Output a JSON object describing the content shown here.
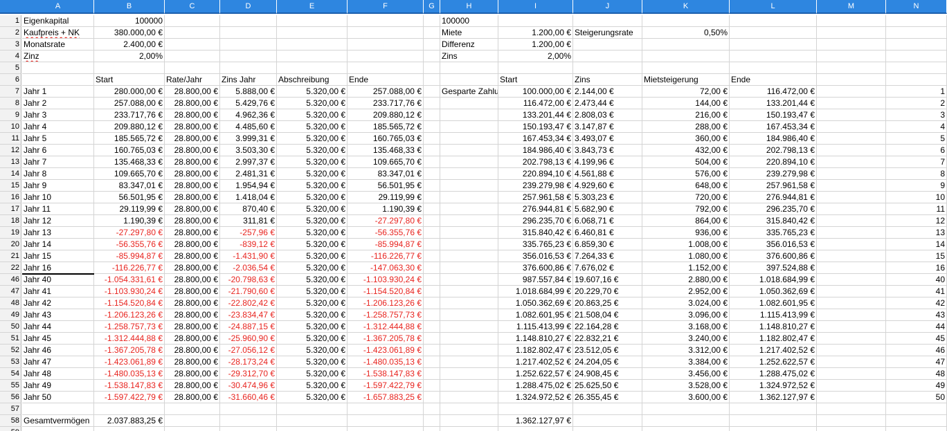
{
  "columns": [
    "A",
    "B",
    "C",
    "D",
    "E",
    "F",
    "G",
    "H",
    "I",
    "J",
    "K",
    "L",
    "M",
    "N"
  ],
  "rows": [
    {
      "n": "1",
      "cells": [
        "Eigenkapital",
        "100000",
        "",
        "",
        "",
        "",
        "",
        "100000",
        "",
        "",
        "",
        "",
        "",
        ""
      ]
    },
    {
      "n": "2",
      "cells": [
        "Kaufpreis + NK",
        "380.000,00 €",
        "",
        "",
        "",
        "",
        "",
        "Miete",
        "1.200,00 €",
        "Steigerungsrate",
        "0,50%",
        "",
        "",
        ""
      ]
    },
    {
      "n": "3",
      "cells": [
        "Monatsrate",
        "2.400,00 €",
        "",
        "",
        "",
        "",
        "",
        "Differenz",
        "1.200,00 €",
        "",
        "",
        "",
        "",
        ""
      ]
    },
    {
      "n": "4",
      "cells": [
        "Zinz",
        "2,00%",
        "",
        "",
        "",
        "",
        "",
        "Zins",
        "2,00%",
        "",
        "",
        "",
        "",
        ""
      ]
    },
    {
      "n": "5",
      "cells": [
        "",
        "",
        "",
        "",
        "",
        "",
        "",
        "",
        "",
        "",
        "",
        "",
        "",
        ""
      ]
    },
    {
      "n": "6",
      "cells": [
        "",
        "Start",
        "Rate/Jahr",
        "Zins Jahr",
        "Abschreibung",
        "Ende",
        "",
        "",
        "Start",
        "Zins",
        "Mietsteigerung",
        "Ende",
        "",
        ""
      ]
    },
    {
      "n": "7",
      "cells": [
        "Jahr 1",
        "280.000,00 €",
        "28.800,00 €",
        "5.888,00 €",
        "5.320,00 €",
        "257.088,00 €",
        "",
        "Gesparte Zahlung",
        "100.000,00 €",
        "2.144,00 €",
        "72,00 €",
        "116.472,00 €",
        "",
        "1"
      ]
    },
    {
      "n": "8",
      "cells": [
        "Jahr 2",
        "257.088,00 €",
        "28.800,00 €",
        "5.429,76 €",
        "5.320,00 €",
        "233.717,76 €",
        "",
        "",
        "116.472,00 €",
        "2.473,44 €",
        "144,00 €",
        "133.201,44 €",
        "",
        "2"
      ]
    },
    {
      "n": "9",
      "cells": [
        "Jahr 3",
        "233.717,76 €",
        "28.800,00 €",
        "4.962,36 €",
        "5.320,00 €",
        "209.880,12 €",
        "",
        "",
        "133.201,44 €",
        "2.808,03 €",
        "216,00 €",
        "150.193,47 €",
        "",
        "3"
      ]
    },
    {
      "n": "10",
      "cells": [
        "Jahr 4",
        "209.880,12 €",
        "28.800,00 €",
        "4.485,60 €",
        "5.320,00 €",
        "185.565,72 €",
        "",
        "",
        "150.193,47 €",
        "3.147,87 €",
        "288,00 €",
        "167.453,34 €",
        "",
        "4"
      ]
    },
    {
      "n": "11",
      "cells": [
        "Jahr 5",
        "185.565,72 €",
        "28.800,00 €",
        "3.999,31 €",
        "5.320,00 €",
        "160.765,03 €",
        "",
        "",
        "167.453,34 €",
        "3.493,07 €",
        "360,00 €",
        "184.986,40 €",
        "",
        "5"
      ]
    },
    {
      "n": "12",
      "cells": [
        "Jahr 6",
        "160.765,03 €",
        "28.800,00 €",
        "3.503,30 €",
        "5.320,00 €",
        "135.468,33 €",
        "",
        "",
        "184.986,40 €",
        "3.843,73 €",
        "432,00 €",
        "202.798,13 €",
        "",
        "6"
      ]
    },
    {
      "n": "13",
      "cells": [
        "Jahr 7",
        "135.468,33 €",
        "28.800,00 €",
        "2.997,37 €",
        "5.320,00 €",
        "109.665,70 €",
        "",
        "",
        "202.798,13 €",
        "4.199,96 €",
        "504,00 €",
        "220.894,10 €",
        "",
        "7"
      ]
    },
    {
      "n": "14",
      "cells": [
        "Jahr 8",
        "109.665,70 €",
        "28.800,00 €",
        "2.481,31 €",
        "5.320,00 €",
        "83.347,01 €",
        "",
        "",
        "220.894,10 €",
        "4.561,88 €",
        "576,00 €",
        "239.279,98 €",
        "",
        "8"
      ]
    },
    {
      "n": "15",
      "cells": [
        "Jahr 9",
        "83.347,01 €",
        "28.800,00 €",
        "1.954,94 €",
        "5.320,00 €",
        "56.501,95 €",
        "",
        "",
        "239.279,98 €",
        "4.929,60 €",
        "648,00 €",
        "257.961,58 €",
        "",
        "9"
      ]
    },
    {
      "n": "16",
      "cells": [
        "Jahr 10",
        "56.501,95 €",
        "28.800,00 €",
        "1.418,04 €",
        "5.320,00 €",
        "29.119,99 €",
        "",
        "",
        "257.961,58 €",
        "5.303,23 €",
        "720,00 €",
        "276.944,81 €",
        "",
        "10"
      ]
    },
    {
      "n": "17",
      "cells": [
        "Jahr 11",
        "29.119,99 €",
        "28.800,00 €",
        "870,40 €",
        "5.320,00 €",
        "1.190,39 €",
        "",
        "",
        "276.944,81 €",
        "5.682,90 €",
        "792,00 €",
        "296.235,70 €",
        "",
        "11"
      ]
    },
    {
      "n": "18",
      "cells": [
        "Jahr 12",
        "1.190,39 €",
        "28.800,00 €",
        "311,81 €",
        "5.320,00 €",
        "-27.297,80 €",
        "",
        "",
        "296.235,70 €",
        "6.068,71 €",
        "864,00 €",
        "315.840,42 €",
        "",
        "12"
      ]
    },
    {
      "n": "19",
      "cells": [
        "Jahr 13",
        "-27.297,80 €",
        "28.800,00 €",
        "-257,96 €",
        "5.320,00 €",
        "-56.355,76 €",
        "",
        "",
        "315.840,42 €",
        "6.460,81 €",
        "936,00 €",
        "335.765,23 €",
        "",
        "13"
      ]
    },
    {
      "n": "20",
      "cells": [
        "Jahr 14",
        "-56.355,76 €",
        "28.800,00 €",
        "-839,12 €",
        "5.320,00 €",
        "-85.994,87 €",
        "",
        "",
        "335.765,23 €",
        "6.859,30 €",
        "1.008,00 €",
        "356.016,53 €",
        "",
        "14"
      ]
    },
    {
      "n": "21",
      "cells": [
        "Jahr 15",
        "-85.994,87 €",
        "28.800,00 €",
        "-1.431,90 €",
        "5.320,00 €",
        "-116.226,77 €",
        "",
        "",
        "356.016,53 €",
        "7.264,33 €",
        "1.080,00 €",
        "376.600,86 €",
        "",
        "15"
      ]
    },
    {
      "n": "22",
      "cells": [
        "Jahr 16",
        "-116.226,77 €",
        "28.800,00 €",
        "-2.036,54 €",
        "5.320,00 €",
        "-147.063,30 €",
        "",
        "",
        "376.600,86 €",
        "7.676,02 €",
        "1.152,00 €",
        "397.524,88 €",
        "",
        "16"
      ]
    },
    {
      "n": "46",
      "cells": [
        "Jahr 40",
        "-1.054.331,61 €",
        "28.800,00 €",
        "-20.798,63 €",
        "5.320,00 €",
        "-1.103.930,24 €",
        "",
        "",
        "987.557,84 €",
        "19.607,16 €",
        "2.880,00 €",
        "1.018.684,99 €",
        "",
        "40"
      ]
    },
    {
      "n": "47",
      "cells": [
        "Jahr 41",
        "-1.103.930,24 €",
        "28.800,00 €",
        "-21.790,60 €",
        "5.320,00 €",
        "-1.154.520,84 €",
        "",
        "",
        "1.018.684,99 €",
        "20.229,70 €",
        "2.952,00 €",
        "1.050.362,69 €",
        "",
        "41"
      ]
    },
    {
      "n": "48",
      "cells": [
        "Jahr 42",
        "-1.154.520,84 €",
        "28.800,00 €",
        "-22.802,42 €",
        "5.320,00 €",
        "-1.206.123,26 €",
        "",
        "",
        "1.050.362,69 €",
        "20.863,25 €",
        "3.024,00 €",
        "1.082.601,95 €",
        "",
        "42"
      ]
    },
    {
      "n": "49",
      "cells": [
        "Jahr 43",
        "-1.206.123,26 €",
        "28.800,00 €",
        "-23.834,47 €",
        "5.320,00 €",
        "-1.258.757,73 €",
        "",
        "",
        "1.082.601,95 €",
        "21.508,04 €",
        "3.096,00 €",
        "1.115.413,99 €",
        "",
        "43"
      ]
    },
    {
      "n": "50",
      "cells": [
        "Jahr 44",
        "-1.258.757,73 €",
        "28.800,00 €",
        "-24.887,15 €",
        "5.320,00 €",
        "-1.312.444,88 €",
        "",
        "",
        "1.115.413,99 €",
        "22.164,28 €",
        "3.168,00 €",
        "1.148.810,27 €",
        "",
        "44"
      ]
    },
    {
      "n": "51",
      "cells": [
        "Jahr 45",
        "-1.312.444,88 €",
        "28.800,00 €",
        "-25.960,90 €",
        "5.320,00 €",
        "-1.367.205,78 €",
        "",
        "",
        "1.148.810,27 €",
        "22.832,21 €",
        "3.240,00 €",
        "1.182.802,47 €",
        "",
        "45"
      ]
    },
    {
      "n": "52",
      "cells": [
        "Jahr 46",
        "-1.367.205,78 €",
        "28.800,00 €",
        "-27.056,12 €",
        "5.320,00 €",
        "-1.423.061,89 €",
        "",
        "",
        "1.182.802,47 €",
        "23.512,05 €",
        "3.312,00 €",
        "1.217.402,52 €",
        "",
        "46"
      ]
    },
    {
      "n": "53",
      "cells": [
        "Jahr 47",
        "-1.423.061,89 €",
        "28.800,00 €",
        "-28.173,24 €",
        "5.320,00 €",
        "-1.480.035,13 €",
        "",
        "",
        "1.217.402,52 €",
        "24.204,05 €",
        "3.384,00 €",
        "1.252.622,57 €",
        "",
        "47"
      ]
    },
    {
      "n": "54",
      "cells": [
        "Jahr 48",
        "-1.480.035,13 €",
        "28.800,00 €",
        "-29.312,70 €",
        "5.320,00 €",
        "-1.538.147,83 €",
        "",
        "",
        "1.252.622,57 €",
        "24.908,45 €",
        "3.456,00 €",
        "1.288.475,02 €",
        "",
        "48"
      ]
    },
    {
      "n": "55",
      "cells": [
        "Jahr 49",
        "-1.538.147,83 €",
        "28.800,00 €",
        "-30.474,96 €",
        "5.320,00 €",
        "-1.597.422,79 €",
        "",
        "",
        "1.288.475,02 €",
        "25.625,50 €",
        "3.528,00 €",
        "1.324.972,52 €",
        "",
        "49"
      ]
    },
    {
      "n": "56",
      "cells": [
        "Jahr 50",
        "-1.597.422,79 €",
        "28.800,00 €",
        "-31.660,46 €",
        "5.320,00 €",
        "-1.657.883,25 €",
        "",
        "",
        "1.324.972,52 €",
        "26.355,45 €",
        "3.600,00 €",
        "1.362.127,97 €",
        "",
        "50"
      ]
    },
    {
      "n": "57",
      "cells": [
        "",
        "",
        "",
        "",
        "",
        "",
        "",
        "",
        "",
        "",
        "",
        "",
        "",
        ""
      ]
    },
    {
      "n": "58",
      "cells": [
        "Gesamtvermögen",
        "2.037.883,25 €",
        "",
        "",
        "",
        "",
        "",
        "",
        "1.362.127,97 €",
        "",
        "",
        "",
        "",
        ""
      ]
    },
    {
      "n": "59",
      "cells": [
        "",
        "",
        "",
        "",
        "",
        "",
        "",
        "",
        "",
        "",
        "",
        "",
        "",
        ""
      ]
    }
  ],
  "colors": {
    "header_bg": "#2e86e0",
    "negative": "#e8241f",
    "grid": "#d4d4d4"
  }
}
